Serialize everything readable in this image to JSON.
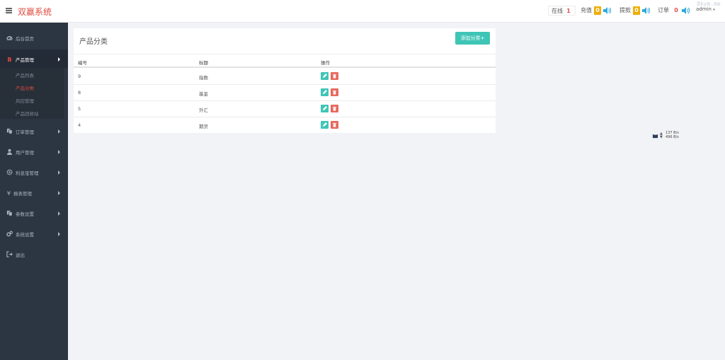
{
  "header": {
    "brand": "双赢系统",
    "online_label": "在线",
    "online_count": "1",
    "recharge_label": "充值",
    "recharge_count": "0",
    "withdraw_label": "提款",
    "withdraw_count": "0",
    "order_label": "订单",
    "order_count": "0",
    "user": "admin",
    "watermark": "8kym.me"
  },
  "colors": {
    "brand": "#e0493f",
    "sidebar": "#2c3542",
    "accent": "#3fc5b6",
    "danger": "#e5695e",
    "warn_badge": "#f0ad00",
    "speaker": "#2ea7e0"
  },
  "sidebar": {
    "items": [
      {
        "label": "后台首页",
        "icon": "dashboard-icon"
      },
      {
        "label": "产品管理",
        "icon": "bitcoin-icon"
      },
      {
        "label": "订单管理",
        "icon": "copy-icon"
      },
      {
        "label": "用户管理",
        "icon": "user-icon"
      },
      {
        "label": "利息宝管理",
        "icon": "cog-icon"
      },
      {
        "label": "报表管理",
        "icon": "yen-icon"
      },
      {
        "label": "参数设置",
        "icon": "copy-icon"
      },
      {
        "label": "系统设置",
        "icon": "cogs-icon"
      },
      {
        "label": "退出",
        "icon": "sign-out-icon"
      }
    ],
    "submenu": [
      "产品列表",
      "产品分类",
      "风控管理",
      "产品回收站"
    ]
  },
  "main": {
    "title": "产品分类",
    "add_button": "添加分类+",
    "columns": [
      "编号",
      "标题",
      "操作"
    ],
    "rows": [
      {
        "id": "9",
        "title": "指数"
      },
      {
        "id": "8",
        "title": "基金"
      },
      {
        "id": "5",
        "title": "外汇"
      },
      {
        "id": "4",
        "title": "期货"
      }
    ]
  },
  "net_widget": {
    "up": "137 B/s",
    "down": "496 B/s"
  }
}
